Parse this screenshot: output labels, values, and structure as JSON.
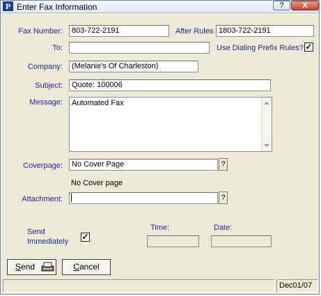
{
  "window": {
    "title": "Enter Fax Information",
    "app_icon_letter": "P",
    "help_label": "?",
    "close_label": "X"
  },
  "fields": {
    "fax_number": {
      "label": "Fax Number:",
      "value": "803-722-2191"
    },
    "after_rules": {
      "label": "After Rules",
      "value": "1803-722-2191"
    },
    "to": {
      "label": "To:",
      "value": ""
    },
    "dialing_prefix": {
      "label": "Use Dialing Prefix Rules?",
      "checked": true,
      "mark": "✓"
    },
    "company": {
      "label": "Company:",
      "value": "(Melanie's Of Charleston)"
    },
    "subject": {
      "label": "Subject:",
      "value": "Quote:  100006"
    },
    "message": {
      "label": "Message:",
      "value": "Automated Fax"
    },
    "coverpage": {
      "label": "Coverpage:",
      "value": "No Cover Page",
      "help": "?",
      "description": "No Cover page"
    },
    "attachment": {
      "label": "Attachment:",
      "value": "",
      "help": "?"
    },
    "send_immediately": {
      "label_line1": "Send",
      "label_line2": "Immediately",
      "checked": true,
      "mark": "✓"
    },
    "time": {
      "label": "Time:",
      "value": ""
    },
    "date": {
      "label": "Date:",
      "value": ""
    }
  },
  "buttons": {
    "send": {
      "label_u": "S",
      "label_rest": "end",
      "icon": "fax-printer-icon"
    },
    "cancel": {
      "label_u": "C",
      "label_rest": "ancel"
    }
  },
  "statusbar": {
    "left": "",
    "right": "Dec01/07"
  }
}
